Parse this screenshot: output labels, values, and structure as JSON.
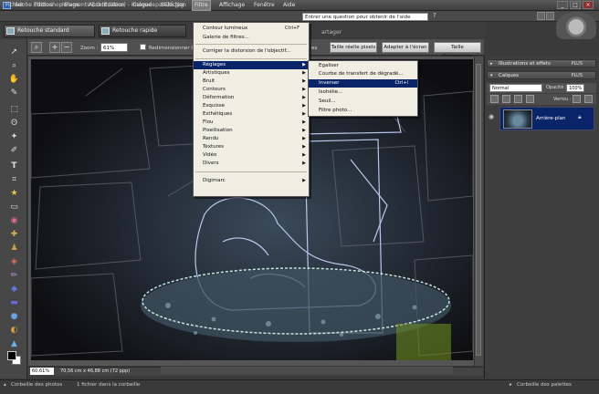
{
  "window": {
    "title": "Adobe Photoshop Elements 5.0 (Editeur) - imagedepart25.jpg"
  },
  "menubar": {
    "items": [
      "Fichier",
      "Edition",
      "Image",
      "Accentuation",
      "Calque",
      "Sélection",
      "Filtre",
      "Affichage",
      "Fenêtre",
      "Aide"
    ],
    "active": "Filtre",
    "help_value": "Entrer une question pour obtenir de l'aide"
  },
  "modes": {
    "standard": "Retouche standard",
    "rapide": "Retouche rapide",
    "share": "artager"
  },
  "options": {
    "zoom_label": "Zoom :",
    "zoom_value": "61%",
    "resize_label": "Redimensionner le",
    "buttons": [
      "es",
      "Taille réelle pixels",
      "Adapter à l'écran",
      "Taille d'impression"
    ]
  },
  "filtre_menu": {
    "items": [
      {
        "label": "Contour lumineux",
        "shortcut": "Ctrl+F"
      },
      {
        "label": "Galerie de filtres..."
      },
      {
        "label": "Corriger la distorsion de l'objectif..."
      },
      {
        "label": "Réglages",
        "submenu": true
      },
      {
        "label": "Artistiques",
        "submenu": true
      },
      {
        "label": "Bruit",
        "submenu": true
      },
      {
        "label": "Contours",
        "submenu": true
      },
      {
        "label": "Déformation",
        "submenu": true
      },
      {
        "label": "Esquisse",
        "submenu": true
      },
      {
        "label": "Esthétiques",
        "submenu": true
      },
      {
        "label": "Flou",
        "submenu": true
      },
      {
        "label": "Pixellisation",
        "submenu": true
      },
      {
        "label": "Rendu",
        "submenu": true
      },
      {
        "label": "Textures",
        "submenu": true
      },
      {
        "label": "Vidéo",
        "submenu": true
      },
      {
        "label": "Divers",
        "submenu": true
      },
      {
        "label": "Digimarc",
        "submenu": true
      }
    ]
  },
  "reglages_submenu": {
    "items": [
      {
        "label": "Egaliser"
      },
      {
        "label": "Courbe de transfert de dégradé..."
      },
      {
        "label": "Inverser",
        "shortcut": "Ctrl+I"
      },
      {
        "label": "Isohélie..."
      },
      {
        "label": "Seuil..."
      },
      {
        "label": "Filtre photo..."
      }
    ]
  },
  "panels": {
    "effects_title": "Illustrations et effets",
    "layers_title": "Calques",
    "more": "PLUS",
    "blend_mode": "Normal",
    "opacity_label": "Opacité :",
    "opacity_value": "100%",
    "lock_label": "Verrou :",
    "layer_name": "Arrière-plan"
  },
  "status": {
    "zoom": "60,61%",
    "doc_size": "70,56 cm x 46,88 cm (72 ppp)"
  },
  "bottom": {
    "photo_bin": "Corbeille des photos",
    "bin_count": "1 fichier dans la corbeille",
    "palette_bin": "Corbeille des palettes"
  },
  "colors": {
    "menu_bg": "#f0ede3",
    "highlight": "#0a246a",
    "ui_dark": "#3a3a3a"
  }
}
